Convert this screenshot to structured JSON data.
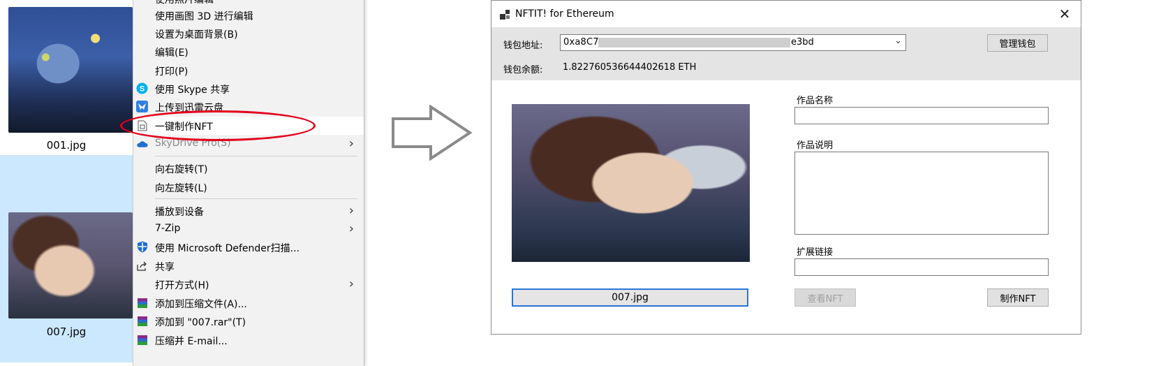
{
  "explorer": {
    "files": [
      {
        "name": "001.jpg",
        "selected": false
      },
      {
        "name": "007.jpg",
        "selected": true
      }
    ]
  },
  "context_menu": {
    "items": [
      {
        "label": "使用照片编辑",
        "icon": ""
      },
      {
        "label": "使用画图 3D 进行编辑",
        "icon": ""
      },
      {
        "label": "设置为桌面背景(B)",
        "icon": ""
      },
      {
        "label": "编辑(E)",
        "icon": ""
      },
      {
        "label": "打印(P)",
        "icon": ""
      },
      {
        "label": "使用 Skype 共享",
        "icon": "skype-icon"
      },
      {
        "label": "上传到迅雷云盘",
        "icon": "xunlei-icon"
      },
      {
        "label": "一键制作NFT",
        "icon": "nft-icon",
        "highlighted": true
      },
      {
        "label": "SkyDrive Pro(S)",
        "icon": "cloud-icon",
        "disabled": true,
        "submenu": true
      },
      {
        "label": "向右旋转(T)",
        "icon": ""
      },
      {
        "label": "向左旋转(L)",
        "icon": ""
      },
      {
        "label": "播放到设备",
        "icon": "",
        "submenu": true
      },
      {
        "label": "7-Zip",
        "icon": "",
        "submenu": true
      },
      {
        "label": "使用 Microsoft Defender扫描...",
        "icon": "defender-shield-icon"
      },
      {
        "label": "共享",
        "icon": "share-icon"
      },
      {
        "label": "打开方式(H)",
        "icon": "",
        "submenu": true
      },
      {
        "label": "添加到压缩文件(A)...",
        "icon": "winrar-icon"
      },
      {
        "label": "添加到 \"007.rar\"(T)",
        "icon": "winrar-icon"
      },
      {
        "label": "压缩并 E-mail...",
        "icon": "winrar-icon"
      }
    ]
  },
  "window": {
    "title": "NFTIT!   for Ethereum",
    "wallet_address_label": "钱包地址:",
    "wallet_address_prefix": "0xa8C7",
    "wallet_address_suffix": "e3bd",
    "manage_wallet_button": "管理钱包",
    "balance_label": "钱包余额:",
    "balance_value": "1.822760536644402618 ETH",
    "file_button": "007.jpg",
    "work_name_label": "作品名称",
    "work_name_value": "",
    "work_desc_label": "作品说明",
    "work_desc_value": "",
    "ext_link_label": "扩展链接",
    "ext_link_value": "",
    "view_nft_button": "查看NFT",
    "make_nft_button": "制作NFT"
  },
  "colors": {
    "highlight_oval": "#e3001b",
    "selection_bg": "#cce8ff",
    "focus_border": "#2a74d6"
  }
}
